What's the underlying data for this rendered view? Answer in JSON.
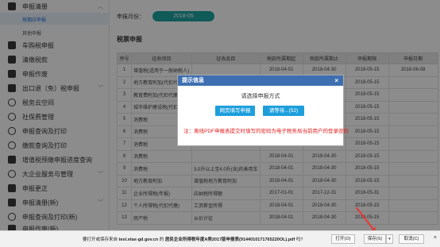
{
  "sidebar": {
    "top_item": "申报清册",
    "sub_active": "按期应申报",
    "sub_other": "其他申报",
    "items": [
      "车购税申报",
      "清缴税款",
      "申报作废",
      "出口退（免）税申报",
      "税务云空间",
      "社保费管理",
      "申报查询及打印",
      "缴款查询及打印",
      "增值税预缴申报进度查询",
      "大企业服务与管理",
      "申报更正",
      "申报清册(新)",
      "申报查询及打印(新)",
      "申报作废(新)"
    ]
  },
  "period": {
    "label": "申报月份：",
    "value": "2018-05"
  },
  "section_title": "税票申报",
  "table": {
    "headers": [
      "序号",
      "征收项目",
      "征收品目",
      "税款所属期起",
      "税款所属期止",
      "申报期限",
      "申报日期"
    ],
    "rows": [
      [
        "1",
        "增值税(适用于一般纳税人)",
        "",
        "2018-04-01",
        "2018-04-30",
        "2018-05-15",
        "2018-06-08"
      ],
      [
        "2",
        "地方教育附加(代扣代缴)",
        "",
        "2018-04-01",
        "2018-04-30",
        "2018-05-15",
        ""
      ],
      [
        "3",
        "教育费附加(代扣代缴)",
        "",
        "2018-04-01",
        "2018-04-30",
        "2018-05-15",
        ""
      ],
      [
        "4",
        "城市维护建设税(代扣代缴)",
        "",
        "2018-04-01",
        "2018-04-30",
        "2018-05-15",
        ""
      ],
      [
        "5",
        "消费税",
        "",
        "2018-04-01",
        "2018-04-30",
        "2018-05-15",
        ""
      ],
      [
        "6",
        "消费税",
        "",
        "2018-04-01",
        "2018-04-30",
        "2018-05-15",
        ""
      ],
      [
        "7",
        "消费税",
        "",
        "2018-04-01",
        "2018-04-30",
        "2018-05-15",
        ""
      ],
      [
        "8",
        "消费税",
        "",
        "2018-04-01",
        "2018-04-30",
        "2018-05-15",
        ""
      ],
      [
        "9",
        "消费税",
        "3.0升以上至4.0升(含)的乘用车",
        "2018-04-01",
        "2018-04-30",
        "2018-05-15",
        ""
      ],
      [
        "10",
        "地方教育附加",
        "增值税地方教育附加",
        "2018-04-01",
        "2018-04-30",
        "2018-05-15",
        ""
      ],
      [
        "11",
        "企业所得税(年报)",
        "应纳税所得额",
        "2017-01-01",
        "2017-12-31",
        "2018-05-31",
        ""
      ],
      [
        "12",
        "个人所得税(代扣代缴)",
        "工资薪金所得",
        "2018-04-01",
        "2018-04-30",
        "2018-05-15",
        ""
      ],
      [
        "13",
        "房产税",
        "从价计征",
        "2018-04-01",
        "2018-04-30",
        "2018-05-15",
        ""
      ]
    ]
  },
  "modal": {
    "title": "提示信息",
    "close": "×",
    "prompt": "请选择申报方式",
    "btn_web": "网页填写申报",
    "btn_wait": "请等待...(52)",
    "note": "注：离线PDF申报表提交时填写的密码为电子税务局当前用户的登录密码"
  },
  "download_bar": {
    "prefix": "要打开或保存来自",
    "site": "test.etax-gd.gov.cn",
    "middle": "的",
    "filename": "居民企业所得税年度A类2017版申报表(9144010171765220OL).pdf",
    "suffix": "吗?",
    "open": "打开(O)",
    "save": "保存(S)",
    "save_arrow": "▾",
    "cancel": "取消(C)",
    "close": "×"
  },
  "colors": {
    "accent_teal": "#1ea4a0",
    "modal_header": "#3e6fb0",
    "button_blue": "#1e9fdc",
    "note_red": "#e02020",
    "arrow_red": "#e53935"
  }
}
